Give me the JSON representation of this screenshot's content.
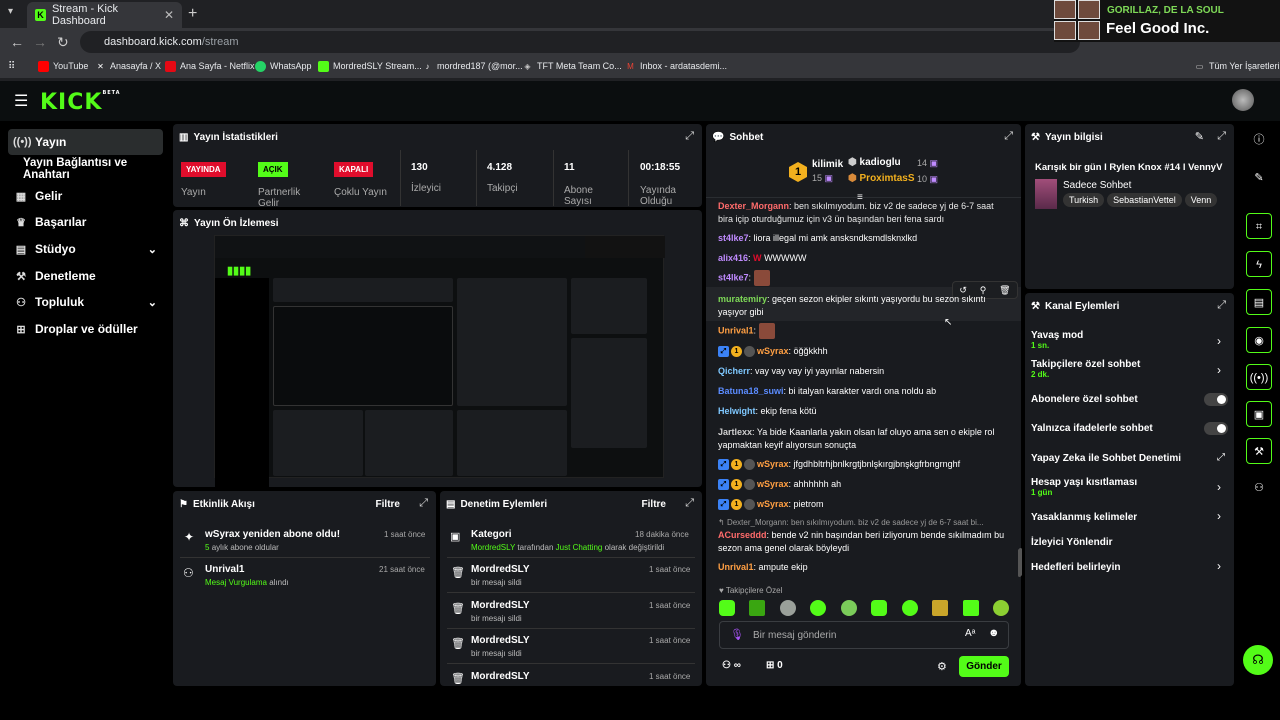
{
  "browser": {
    "tab_title": "Stream - Kick Dashboard",
    "url_host": "dashboard.kick.com",
    "url_path": "/stream",
    "bookmarks": [
      "YouTube",
      "Anasayfa / X",
      "Ana Sayfa - Netflix",
      "WhatsApp",
      "MordredSLY Stream...",
      "mordred187 (@mor...",
      "TFT Meta Team Co...",
      "Inbox - ardatasdemi..."
    ],
    "bookmarks_folder": "Tüm Yer İşaretleri"
  },
  "now_playing": {
    "artist": "GORILLAZ, DE LA SOUL",
    "song": "Feel Good Inc."
  },
  "logo": "KICK",
  "logo_sup": "BETA",
  "sidebar": {
    "items": [
      {
        "label": "Yayın",
        "icon": "broadcast-icon"
      },
      {
        "label": "Yayın Bağlantısı ve Anahtarı"
      },
      {
        "label": "Gelir",
        "icon": "income-icon"
      },
      {
        "label": "Başarılar",
        "icon": "trophy-icon"
      },
      {
        "label": "Stüdyo",
        "icon": "studio-icon"
      },
      {
        "label": "Denetleme",
        "icon": "wrench-icon"
      },
      {
        "label": "Topluluk",
        "icon": "community-icon"
      },
      {
        "label": "Droplar ve ödüller",
        "icon": "gift-icon"
      }
    ]
  },
  "stats": {
    "title": "Yayın İstatistikleri",
    "items": [
      {
        "badge": "YAYINDA",
        "label": "Yayın"
      },
      {
        "badge": "AÇIK",
        "label": "Partnerlik Gelir"
      },
      {
        "badge": "KAPALI",
        "label": "Çoklu Yayın"
      },
      {
        "value": "130",
        "label": "İzleyici"
      },
      {
        "value": "4.128",
        "label": "Takipçi"
      },
      {
        "value": "11",
        "label": "Abone Sayısı"
      },
      {
        "value": "00:18:55",
        "label": "Yayında Olduğu"
      }
    ]
  },
  "preview": {
    "title": "Yayın Ön İzlemesi"
  },
  "activity": {
    "title": "Etkinlik Akışı",
    "filter": "Filtre",
    "items": [
      {
        "name": "wSyrax yeniden abone oldu!",
        "sub_green": "5",
        "sub_rest": "aylık abone oldular",
        "time": "1 saat önce"
      },
      {
        "name": "Unrival1",
        "sub_green": "Mesaj Vurgulama",
        "sub_rest": "alındı",
        "time": "21 saat önce"
      }
    ]
  },
  "moderation": {
    "title": "Denetim Eylemleri",
    "filter": "Filtre",
    "items": [
      {
        "name": "Kategori",
        "sub": "MordredSLY tarafından Just Chatting olarak değiştirildi",
        "sub_user": "MordredSLY",
        "sub_mid": "tarafından",
        "sub_cat": "Just Chatting",
        "sub_end": "olarak değiştirildi",
        "time": "18 dakika önce"
      },
      {
        "name": "MordredSLY",
        "sub": "bir mesajı sildi",
        "time": "1 saat önce"
      },
      {
        "name": "MordredSLY",
        "sub": "bir mesajı sildi",
        "time": "1 saat önce"
      },
      {
        "name": "MordredSLY",
        "sub": "bir mesajı sildi",
        "time": "1 saat önce"
      },
      {
        "name": "MordredSLY",
        "sub": "",
        "time": "1 saat önce"
      }
    ]
  },
  "chat": {
    "title": "Sohbet",
    "top_gifters": [
      {
        "name": "kilimik",
        "count": "15"
      },
      {
        "name": "kadioglu",
        "count": "14"
      },
      {
        "name": "ProximtasS",
        "count": "10"
      }
    ],
    "rank": "1",
    "messages": [
      {
        "user": "Dexter_Morgann",
        "text": "ben sıkılmıyodum. biz v2 de sadece yj de 6-7 saat bira içip oturduğumuz için v3 ün başından beri fena sardı",
        "color": "#ff6b6b"
      },
      {
        "user": "st4lke7",
        "text": "liora illegal mi amk ansksndksmdlsknxlkd",
        "color": "#c08bff"
      },
      {
        "user": "alix416",
        "text": "WWWWW",
        "color": "#c08bff"
      },
      {
        "user": "st4lke7",
        "text": "",
        "color": "#c08bff"
      },
      {
        "user": "muratemiry",
        "text": "geçen sezon ekipler sıkıntı yaşıyordu bu sezon sıkıntı yaşıyor gibi",
        "color": "#7ed957"
      },
      {
        "user": "Unrival1",
        "text": "",
        "color": "#ff9f43"
      },
      {
        "user": "wSyrax",
        "text": "öğğkkhh",
        "color": "#ff9f43"
      },
      {
        "user": "Qicherr",
        "text": "vay vay vay iyi yayınlar nabersin",
        "color": "#7fc8ff"
      },
      {
        "user": "Batuna18_suwi",
        "text": "bi italyan karakter vardı ona noldu ab",
        "color": "#5b8cff"
      },
      {
        "user": "Helwight",
        "text": "ekip fena kötü",
        "color": "#7fc8ff"
      },
      {
        "user": "Jartlexx",
        "text": "Ya bide Kaanlarla yakın olsan laf oluyo ama sen o ekiple rol yapmaktan keyif alıyorsun sonuçta",
        "color": "#cfcfcf"
      },
      {
        "user": "wSyrax",
        "text": "jfgdhbltrhjbnlkrgtjbnlşkırgjbnşkgfrbngrnghf",
        "color": "#ff9f43"
      },
      {
        "user": "wSyrax",
        "text": "ahhhhhh ah",
        "color": "#ff9f43"
      },
      {
        "user": "wSyrax",
        "text": "pietrom",
        "color": "#ff9f43"
      },
      {
        "user": "ACurseddd",
        "text": "bende v2 nin başından beri izliyorum bende sıkılmadım bu sezon ama genel olarak böyleydi",
        "color": "#ff6b6b",
        "reply": "Dexter_Morgann: ben sıkılmıyodum. biz v2 de sadece yj de 6-7 saat bi..."
      },
      {
        "user": "Unrival1",
        "text": "ampute ekip",
        "color": "#ff9f43"
      }
    ],
    "followers_only": "Takipçilere Özel",
    "input_placeholder": "Bir mesaj gönderin",
    "infinity": "∞",
    "gift_count": "0",
    "send": "Gönder"
  },
  "stream_info": {
    "title": "Yayın bilgisi",
    "stream_title": "Karışık bir gün l Rylen Knox #14 l VennyV",
    "category": "Sadece Sohbet",
    "tags": [
      "Turkish",
      "SebastianVettel",
      "Venn"
    ]
  },
  "channel_actions": {
    "title": "Kanal Eylemleri",
    "items": [
      {
        "label": "Yavaş mod",
        "sub": "1 sn.",
        "type": "chevron"
      },
      {
        "label": "Takipçilere özel sohbet",
        "sub": "2 dk.",
        "type": "chevron"
      },
      {
        "label": "Abonelere özel sohbet",
        "sub": "",
        "type": "toggle"
      },
      {
        "label": "Yalnızca ifadelerle sohbet",
        "sub": "",
        "type": "toggle"
      },
      {
        "label": "Yapay Zeka ile Sohbet Denetimi",
        "sub": "",
        "type": "external"
      },
      {
        "label": "Hesap yaşı kısıtlaması",
        "sub": "1 gün",
        "type": "chevron"
      },
      {
        "label": "Yasaklanmış kelimeler",
        "sub": "",
        "type": "chevron"
      },
      {
        "label": "İzleyici Yönlendir",
        "sub": "",
        "type": "none"
      },
      {
        "label": "Hedefleri belirleyin",
        "sub": "",
        "type": "chevron"
      }
    ]
  },
  "colors": {
    "accent": "#53fc18",
    "live_red": "#e00d2c",
    "panel": "#191b1f"
  }
}
